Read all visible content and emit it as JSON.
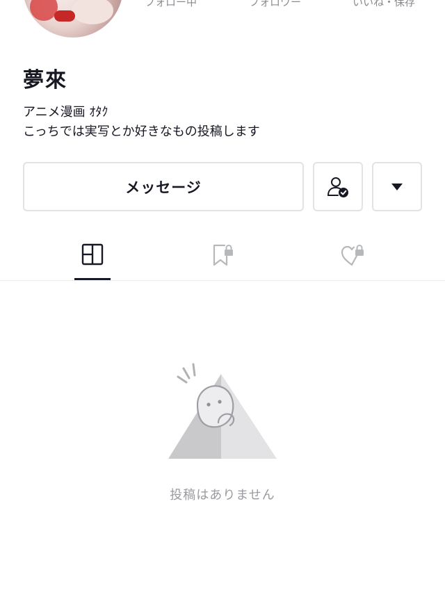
{
  "profile": {
    "display_name": "夢來",
    "bio_line1": "アニメ漫画 ｵﾀｸ",
    "bio_line2": "こっちでは実写とか好きなもの投稿します"
  },
  "stats": {
    "following_label": "フォロー中",
    "followers_label": "フォロワー",
    "likes_label": "いいね・保存"
  },
  "actions": {
    "message_label": "メッセージ"
  },
  "tabs": [
    {
      "id": "videos",
      "icon": "grid-icon",
      "active": true
    },
    {
      "id": "favorites",
      "icon": "bookmark-lock-icon",
      "active": false
    },
    {
      "id": "liked",
      "icon": "heart-lock-icon",
      "active": false
    }
  ],
  "empty_state": {
    "message": "投稿はありません"
  },
  "colors": {
    "text_primary": "#161823",
    "text_muted": "#8a8b91",
    "border": "#e3e3e4",
    "accent_check": "#161823"
  }
}
